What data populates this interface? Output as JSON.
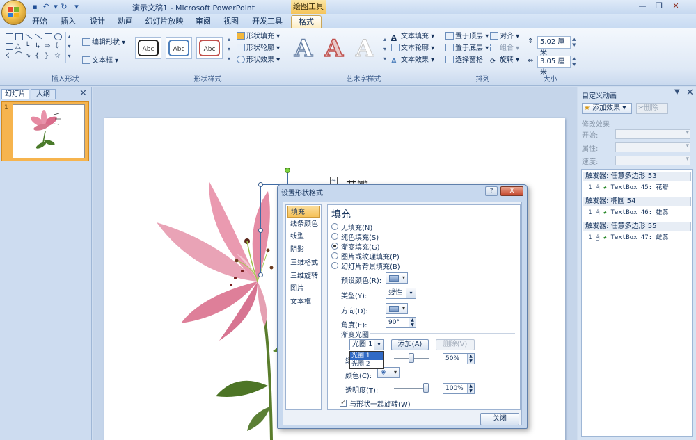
{
  "titlebar": {
    "title": "演示文稿1 - Microsoft PowerPoint",
    "contextual_tab_group": "绘图工具"
  },
  "tabs": [
    "开始",
    "插入",
    "设计",
    "动画",
    "幻灯片放映",
    "审阅",
    "视图",
    "开发工具",
    "格式"
  ],
  "ribbon": {
    "insert_shapes": {
      "label": "插入形状",
      "edit_shape": "编辑形状",
      "text_box": "文本框"
    },
    "shape_styles": {
      "label": "形状样式",
      "swatch_text": "Abc",
      "shape_fill": "形状填充",
      "shape_outline": "形状轮廓",
      "shape_effects": "形状效果"
    },
    "wordart_styles": {
      "label": "艺术字样式",
      "sample": "A",
      "text_fill": "文本填充",
      "text_outline": "文本轮廓",
      "text_effects": "文本效果"
    },
    "arrange": {
      "label": "排列",
      "bring_front": "置于顶层",
      "send_back": "置于底层",
      "selection_pane": "选择窗格",
      "align": "对齐",
      "group": "组合",
      "rotate": "旋转"
    },
    "size": {
      "label": "大小",
      "height": "5.02 厘米",
      "width": "3.05 厘米"
    }
  },
  "left_panel": {
    "tab_slides": "幻灯片",
    "tab_outline": "大纲",
    "slide_number": "1"
  },
  "slide": {
    "label_text": "花瓣"
  },
  "right_panel": {
    "title": "自定义动画",
    "add_effect": "添加效果",
    "delete": "删除",
    "modify_label": "修改效果",
    "start_label": "开始:",
    "property_label": "属性:",
    "speed_label": "速度:",
    "triggers": [
      {
        "trigger": "触发器: 任意多边形 53",
        "effect_num": "1",
        "effect": "TextBox 45: 花瓣"
      },
      {
        "trigger": "触发器: 椭圆 54",
        "effect_num": "1",
        "effect": "TextBox 46: 雄蕊"
      },
      {
        "trigger": "触发器: 任意多边形 55",
        "effect_num": "1",
        "effect": "TextBox 47: 雌蕊"
      }
    ]
  },
  "dialog": {
    "title": "设置形状格式",
    "help": "?",
    "close_x": "X",
    "nav": [
      "填充",
      "线条颜色",
      "线型",
      "阴影",
      "三维格式",
      "三维旋转",
      "图片",
      "文本框"
    ],
    "heading": "填充",
    "fill_options": [
      "无填充(N)",
      "纯色填充(S)",
      "渐变填充(G)",
      "图片或纹理填充(P)",
      "幻灯片背景填充(B)"
    ],
    "selected_fill": "渐变填充(G)",
    "preset_colors_label": "预设颜色(R):",
    "type_label": "类型(Y):",
    "type_value": "线性",
    "direction_label": "方向(D):",
    "angle_label": "角度(E):",
    "angle_value": "90°",
    "gradient_stops_label": "渐变光圈",
    "stop_value": "光圈 1",
    "stop_options": [
      "光圈 1",
      "光圈 2"
    ],
    "add_button": "添加(A)",
    "delete_button": "删除(V)",
    "position_label_fragment": "结",
    "position_value": "50%",
    "color_label": "颜色(C):",
    "transparency_label": "透明度(T):",
    "transparency_value": "100%",
    "rotate_with_shape": "与形状一起旋转(W)",
    "close_button": "关闭"
  },
  "colors": {
    "accent_orange": "#f6c25a",
    "ribbon_blue": "#cfddef",
    "selection_blue": "#316ac5"
  }
}
